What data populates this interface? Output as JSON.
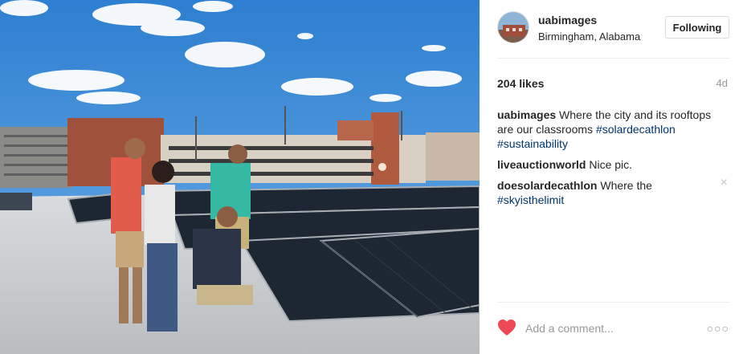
{
  "post": {
    "photo_alt": "Group of people inspecting rooftop solar panels",
    "username": "uabimages",
    "location": "Birmingham, Alabama",
    "follow_label": "Following",
    "likes": "204 likes",
    "time_ago": "4d",
    "caption": {
      "user": "uabimages",
      "text": " Where the city and its rooftops are our classrooms ",
      "tags": [
        "#solardecathlon",
        "#sustainability"
      ]
    },
    "comments": [
      {
        "user": "liveauctionworld",
        "text": " Nice pic.",
        "tag": ""
      },
      {
        "user": "doesolardecathlon",
        "text": " Where the ",
        "tag": "#skyisthelimit"
      }
    ],
    "comment_placeholder": "Add a comment...",
    "more_label": "○○○",
    "delete_label": "×"
  },
  "colors": {
    "heart": "#ed4956",
    "link": "#003569",
    "muted": "#999999"
  },
  "icons": [
    "heart-icon",
    "more-icon",
    "close-icon"
  ]
}
